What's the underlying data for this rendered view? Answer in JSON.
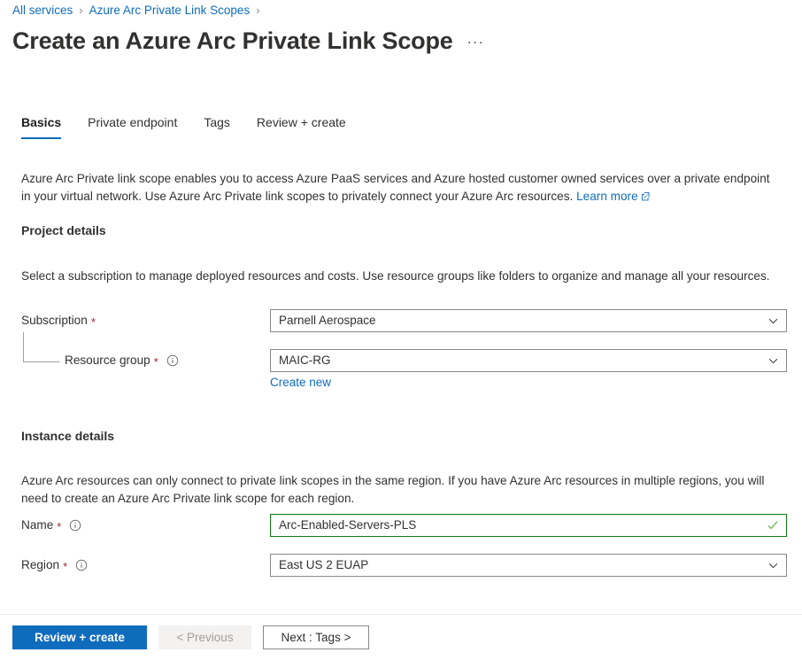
{
  "breadcrumb": {
    "items": [
      {
        "label": "All services"
      },
      {
        "label": "Azure Arc Private Link Scopes"
      }
    ],
    "separator": "›"
  },
  "header": {
    "title": "Create an Azure Arc Private Link Scope",
    "more_label": "···"
  },
  "tabs": [
    {
      "label": "Basics",
      "active": true
    },
    {
      "label": "Private endpoint",
      "active": false
    },
    {
      "label": "Tags",
      "active": false
    },
    {
      "label": "Review + create",
      "active": false
    }
  ],
  "intro": {
    "text": "Azure Arc Private link scope enables you to access Azure PaaS services and Azure hosted customer owned services over a private endpoint in your virtual network. Use Azure Arc Private link scopes to privately connect your Azure Arc resources.",
    "learn_more": "Learn more"
  },
  "project_details": {
    "heading": "Project details",
    "description": "Select a subscription to manage deployed resources and costs. Use resource groups like folders to organize and manage all your resources.",
    "subscription": {
      "label": "Subscription",
      "required": "*",
      "value": "Parnell Aerospace"
    },
    "resource_group": {
      "label": "Resource group",
      "required": "*",
      "value": "MAIC-RG",
      "create_new": "Create new"
    }
  },
  "instance_details": {
    "heading": "Instance details",
    "description": "Azure Arc resources can only connect to private link scopes in the same region. If you have Azure Arc resources in multiple regions, you will need to create an Azure Arc Private link scope for each region.",
    "name": {
      "label": "Name",
      "required": "*",
      "value": "Arc-Enabled-Servers-PLS",
      "validation": "valid"
    },
    "region": {
      "label": "Region",
      "required": "*",
      "value": "East US 2 EUAP"
    }
  },
  "footer": {
    "review_create": "Review + create",
    "previous": "< Previous",
    "next": "Next : Tags >"
  },
  "colors": {
    "accent": "#0f6cbd",
    "required": "#a4262c",
    "valid": "#107c10",
    "border": "#8a8886",
    "text": "#323130"
  }
}
